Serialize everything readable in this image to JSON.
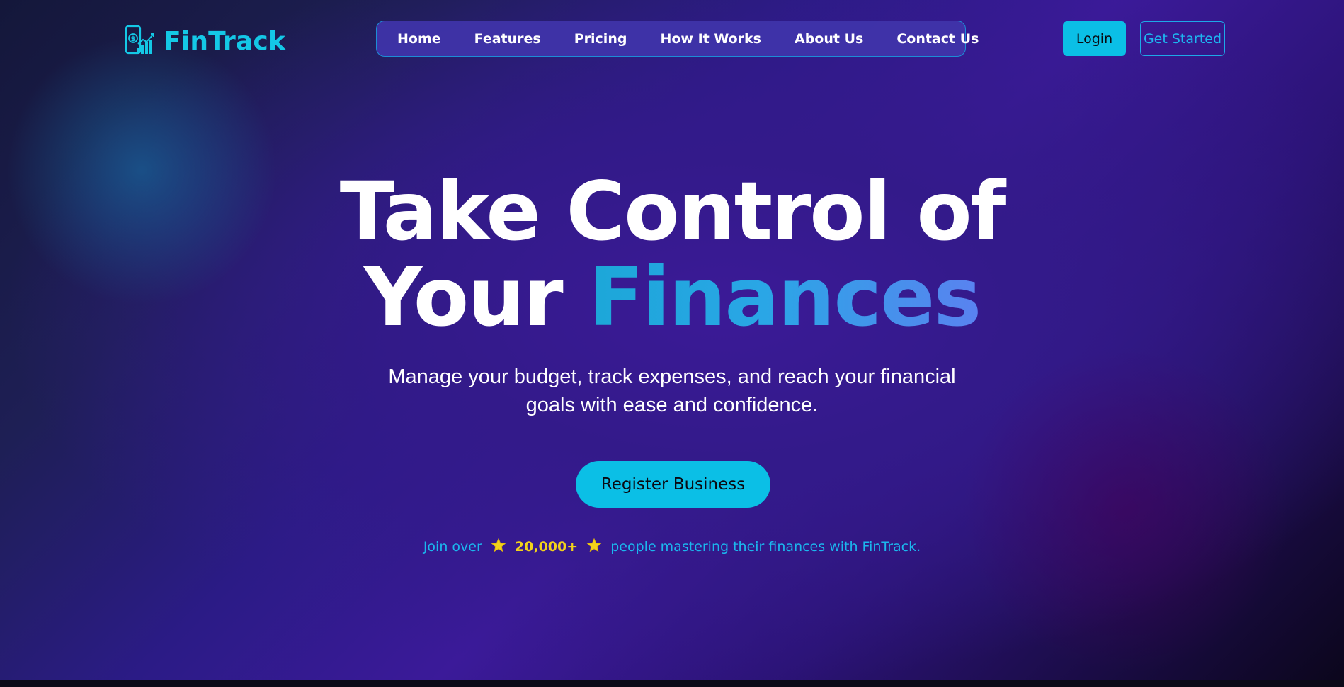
{
  "brand": {
    "name": "FinTrack",
    "logo_icon": "finance-growth-icon",
    "accent_color": "#14c8e6"
  },
  "nav": {
    "items": [
      {
        "label": "Home"
      },
      {
        "label": "Features"
      },
      {
        "label": "Pricing"
      },
      {
        "label": "How It Works"
      },
      {
        "label": "About Us"
      },
      {
        "label": "Contact Us"
      }
    ]
  },
  "header_buttons": {
    "login_label": "Login",
    "get_started_label": "Get Started"
  },
  "hero": {
    "title_line1": "Take Control of",
    "title_line2_prefix": "Your",
    "title_line2_highlight": "Finances",
    "subtitle_line1": "Manage your budget, track expenses, and reach your financial",
    "subtitle_line2": "goals with ease and confidence.",
    "cta_label": "Register Business",
    "join_prefix": "Join over",
    "join_count": "20,000+",
    "join_suffix": "people mastering their finances with FinTrack.",
    "star_icon": "star-icon",
    "star_color": "#f2d21b"
  }
}
